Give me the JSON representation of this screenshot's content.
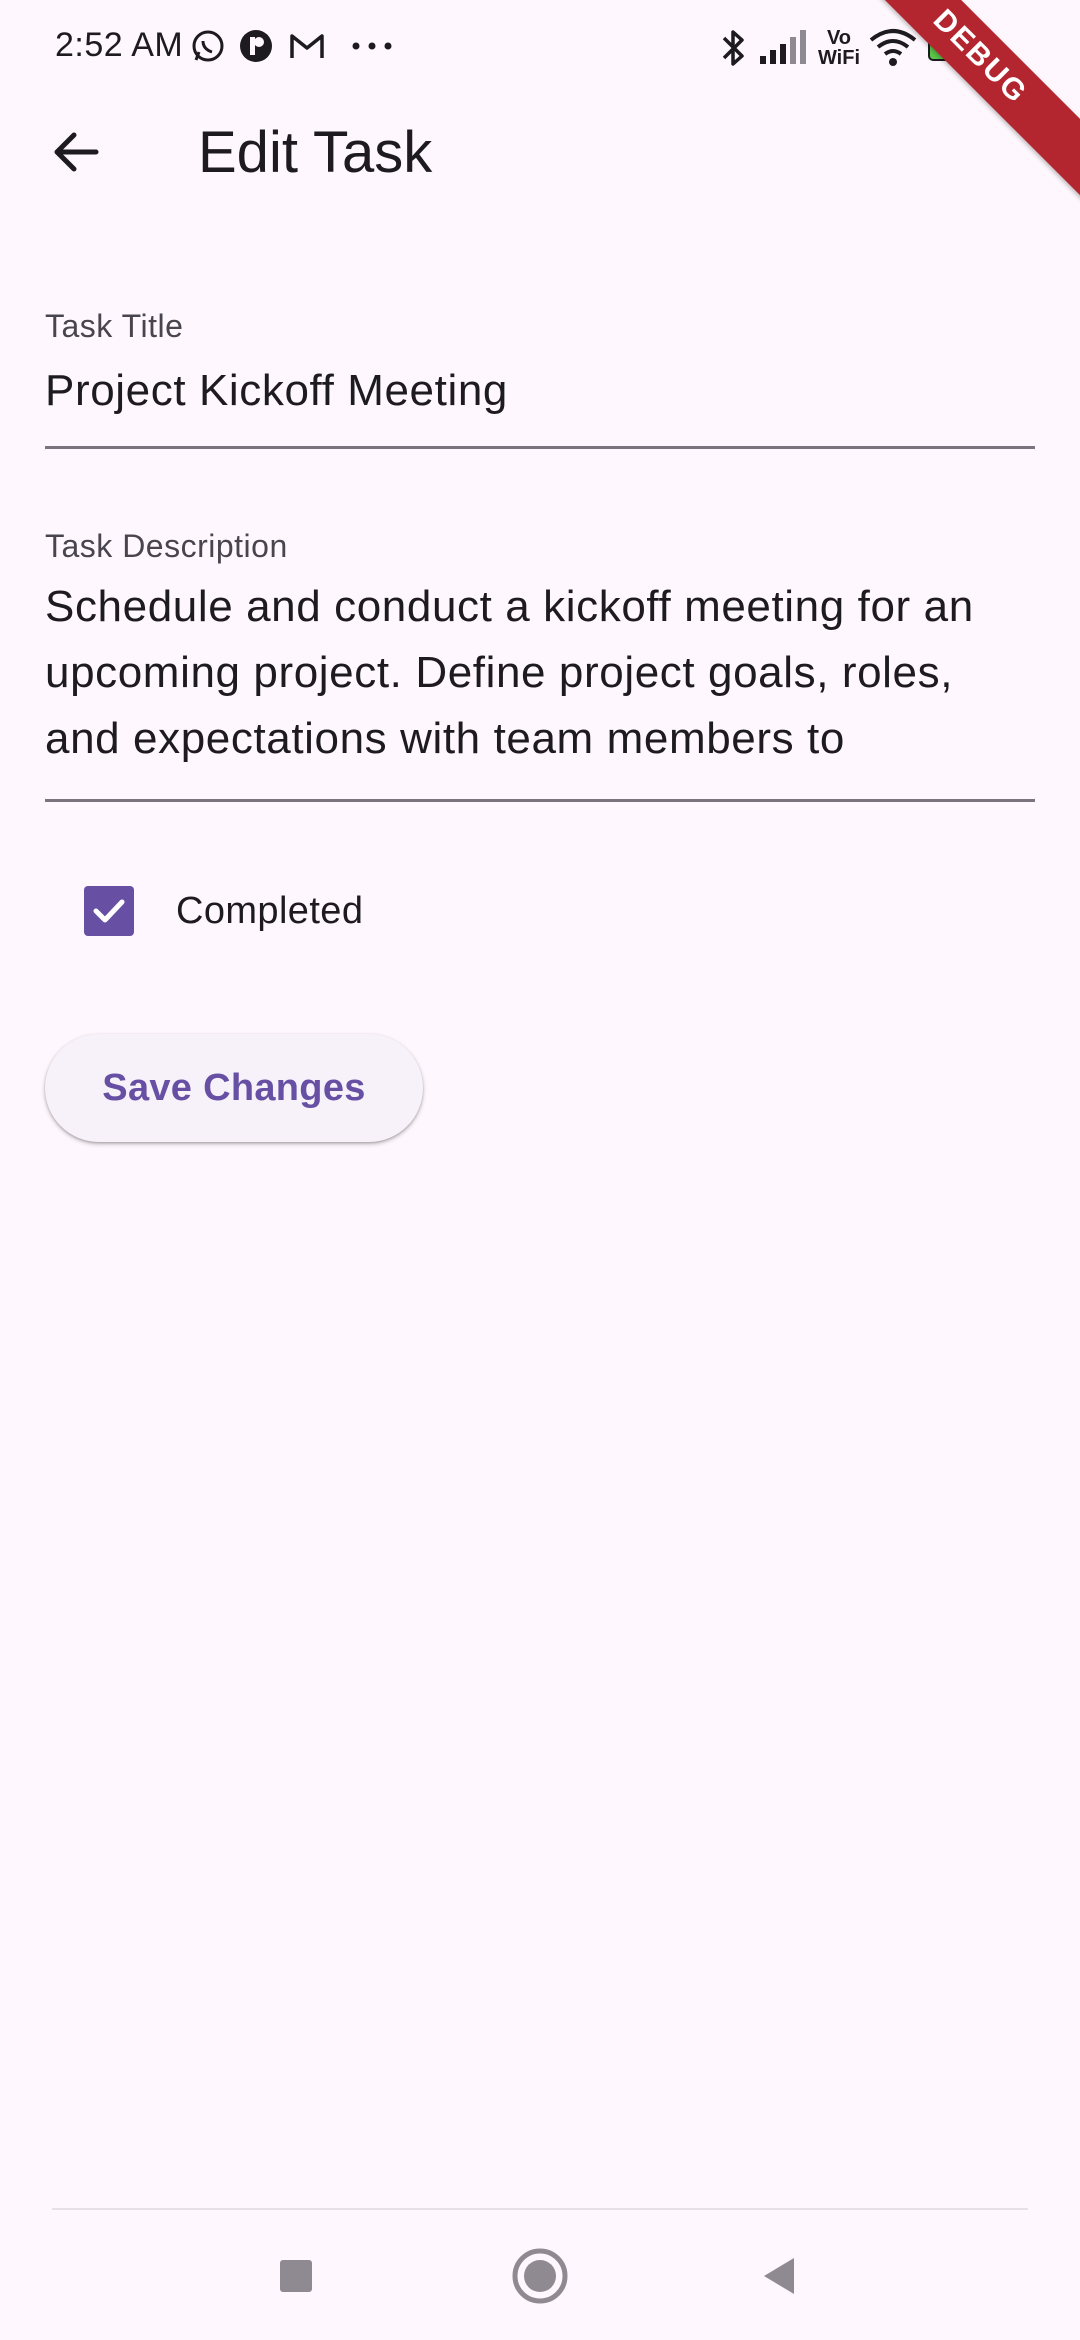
{
  "status_bar": {
    "time": "2:52 AM",
    "left_icons": [
      "whatsapp-icon",
      "app-icon",
      "gmail-icon",
      "more-dots-icon"
    ],
    "right_icons": [
      "bluetooth-icon",
      "signal-icon",
      "vowifi-icon",
      "wifi-icon",
      "battery-icon"
    ],
    "vowifi_top": "Vo",
    "vowifi_bottom": "WiFi",
    "battery_level": "100"
  },
  "debug_banner": "DEBUG",
  "app_bar": {
    "title": "Edit Task",
    "back_icon": "arrow-back-icon"
  },
  "form": {
    "title_label": "Task Title",
    "title_value": "Project Kickoff Meeting",
    "description_label": "Task Description",
    "description_value": "Schedule and conduct a kickoff meeting for an upcoming project. Define project goals, roles, and expectations with team members to",
    "completed_label": "Completed",
    "completed_checked": true
  },
  "actions": {
    "save_label": "Save Changes"
  },
  "colors": {
    "primary": "#6750a4",
    "background": "#fef7fd",
    "debug": "#b3262f"
  },
  "nav_bar": {
    "icons": [
      "recents-square-icon",
      "home-circle-icon",
      "back-triangle-icon"
    ]
  }
}
